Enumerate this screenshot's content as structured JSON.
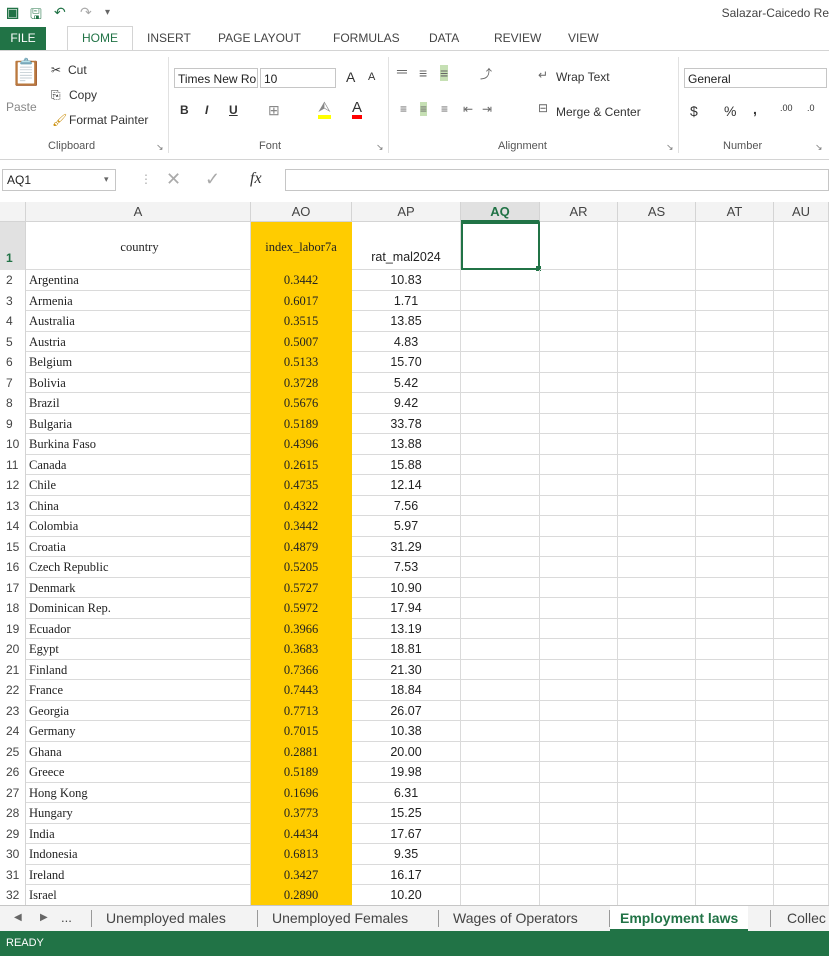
{
  "window": {
    "title": "Salazar-Caicedo Re"
  },
  "ribbon_tabs": [
    "FILE",
    "HOME",
    "INSERT",
    "PAGE LAYOUT",
    "FORMULAS",
    "DATA",
    "REVIEW",
    "VIEW"
  ],
  "clipboard": {
    "paste": "Paste",
    "cut": "Cut",
    "copy": "Copy",
    "format_painter": "Format Painter",
    "label": "Clipboard"
  },
  "font": {
    "name": "Times New Ro",
    "size": "10",
    "label": "Font",
    "bold": "B",
    "italic": "I",
    "underline": "U",
    "grow": "A",
    "shrink": "A",
    "font_color": "A"
  },
  "alignment": {
    "wrap_text": "Wrap Text",
    "merge_center": "Merge & Center",
    "label": "Alignment"
  },
  "number": {
    "format": "General",
    "label": "Number",
    "currency": "$",
    "percent": "%",
    "comma": ",",
    "inc_decimal": ".00",
    "dec_decimal": ".0"
  },
  "formula_bar": {
    "name_box": "AQ1",
    "fx": "fx",
    "value": ""
  },
  "columns": [
    "A",
    "AO",
    "AP",
    "AQ",
    "AR",
    "AS",
    "AT",
    "AU"
  ],
  "header_row": {
    "row": "1",
    "A": "country",
    "AO": "index_labor7a",
    "AP": "rat_mal2024"
  },
  "rows": [
    [
      "2",
      "Argentina",
      "0.3442",
      "10.83"
    ],
    [
      "3",
      "Armenia",
      "0.6017",
      "1.71"
    ],
    [
      "4",
      "Australia",
      "0.3515",
      "13.85"
    ],
    [
      "5",
      "Austria",
      "0.5007",
      "4.83"
    ],
    [
      "6",
      "Belgium",
      "0.5133",
      "15.70"
    ],
    [
      "7",
      "Bolivia",
      "0.3728",
      "5.42"
    ],
    [
      "8",
      "Brazil",
      "0.5676",
      "9.42"
    ],
    [
      "9",
      "Bulgaria",
      "0.5189",
      "33.78"
    ],
    [
      "10",
      "Burkina Faso",
      "0.4396",
      "13.88"
    ],
    [
      "11",
      "Canada",
      "0.2615",
      "15.88"
    ],
    [
      "12",
      "Chile",
      "0.4735",
      "12.14"
    ],
    [
      "13",
      "China",
      "0.4322",
      "7.56"
    ],
    [
      "14",
      "Colombia",
      "0.3442",
      "5.97"
    ],
    [
      "15",
      "Croatia",
      "0.4879",
      "31.29"
    ],
    [
      "16",
      "Czech Republic",
      "0.5205",
      "7.53"
    ],
    [
      "17",
      "Denmark",
      "0.5727",
      "10.90"
    ],
    [
      "18",
      "Dominican Rep.",
      "0.5972",
      "17.94"
    ],
    [
      "19",
      "Ecuador",
      "0.3966",
      "13.19"
    ],
    [
      "20",
      "Egypt",
      "0.3683",
      "18.81"
    ],
    [
      "21",
      "Finland",
      "0.7366",
      "21.30"
    ],
    [
      "22",
      "France",
      "0.7443",
      "18.84"
    ],
    [
      "23",
      "Georgia",
      "0.7713",
      "26.07"
    ],
    [
      "24",
      "Germany",
      "0.7015",
      "10.38"
    ],
    [
      "25",
      "Ghana",
      "0.2881",
      "20.00"
    ],
    [
      "26",
      "Greece",
      "0.5189",
      "19.98"
    ],
    [
      "27",
      "Hong Kong",
      "0.1696",
      "6.31"
    ],
    [
      "28",
      "Hungary",
      "0.3773",
      "15.25"
    ],
    [
      "29",
      "India",
      "0.4434",
      "17.67"
    ],
    [
      "30",
      "Indonesia",
      "0.6813",
      "9.35"
    ],
    [
      "31",
      "Ireland",
      "0.3427",
      "16.17"
    ],
    [
      "32",
      "Israel",
      "0.2890",
      "10.20"
    ]
  ],
  "sheet_tabs": {
    "nav_more": "...",
    "tabs": [
      "Unemployed males",
      "Unemployed Females",
      "Wages of Operators",
      "Employment laws",
      "Collec"
    ],
    "active": "Employment laws"
  },
  "status": {
    "text": "READY"
  },
  "colors": {
    "accent": "#217346",
    "highlight": "#ffcc00"
  }
}
